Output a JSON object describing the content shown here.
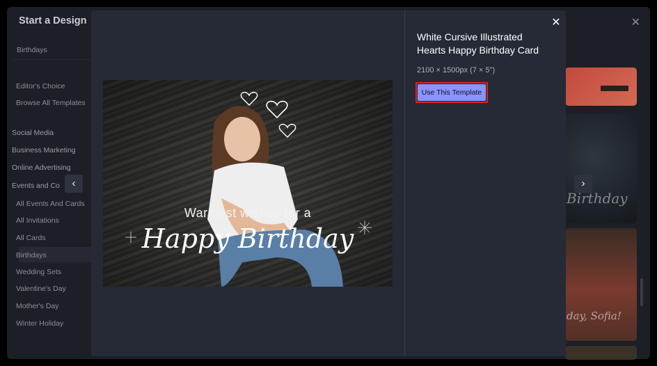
{
  "background": {
    "title": "Start a Design",
    "search_value": "Birthdays",
    "top_items": [
      "Editor's Choice",
      "Browse All Templates"
    ],
    "categories": [
      "Social Media",
      "Business Marketing",
      "Online Advertising",
      "Events and Co"
    ],
    "sub_items": [
      "All Events And Cards",
      "All Invitations",
      "All Cards",
      "Birthdays",
      "Wedding Sets",
      "Valentine's Day",
      "Mother's Day",
      "Winter Holiday"
    ],
    "active_sub_item": "Birthdays",
    "thumb_texts": [
      "Birthday",
      "day, Sofia!"
    ]
  },
  "modal": {
    "title": "White Cursive Illustrated Hearts Happy Birthday Card",
    "dimensions": "2100 × 1500px (7 × 5\")",
    "use_button_label": "Use This Template",
    "close_icon": "close-icon",
    "prev_icon": "chevron-left-icon",
    "next_icon": "chevron-right-icon"
  },
  "card": {
    "line1": "Warmest wishes for a",
    "line2": "Happy Birthday"
  },
  "colors": {
    "accent_button": "#8a93ff",
    "highlight": "#e0231c",
    "modal_bg": "#252a36"
  }
}
